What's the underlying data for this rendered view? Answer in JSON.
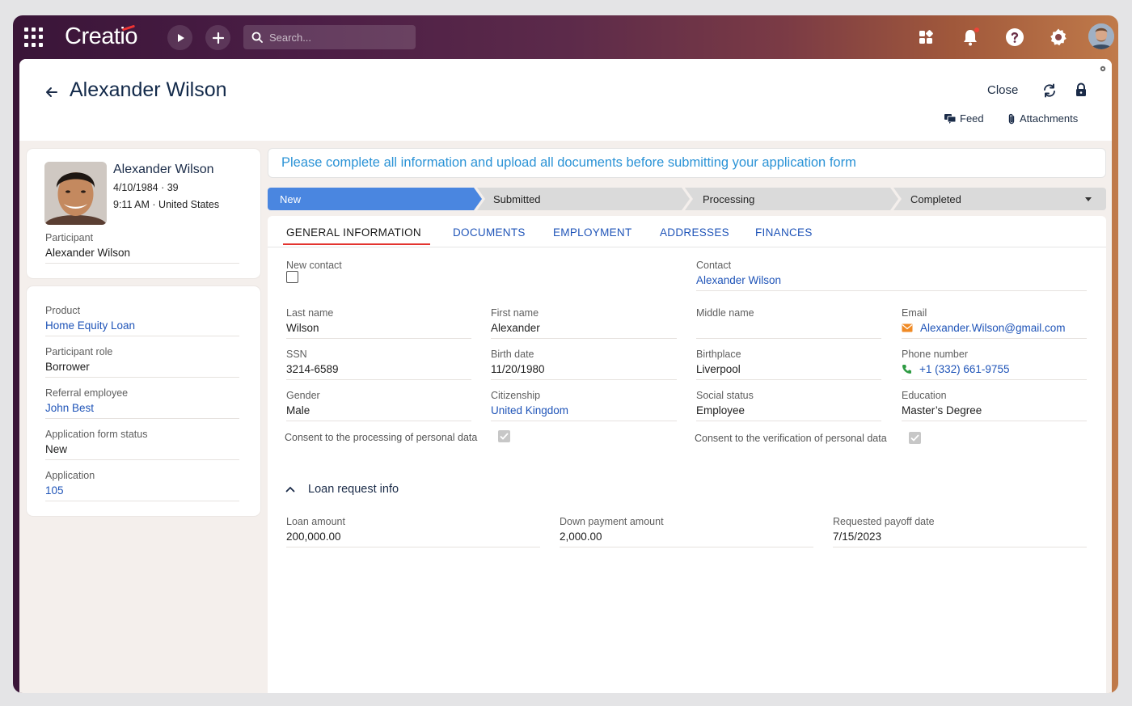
{
  "topbar": {
    "logo": "Creatio",
    "search_placeholder": "Search..."
  },
  "header": {
    "title": "Alexander Wilson",
    "close_label": "Close",
    "feed_label": "Feed",
    "attachments_label": "Attachments"
  },
  "profile": {
    "name": "Alexander Wilson",
    "dob_age": "4/10/1984 · 39",
    "time_location": "9:11 AM · United States",
    "participant_label": "Participant",
    "participant_value": "Alexander Wilson"
  },
  "details": {
    "product_label": "Product",
    "product_value": "Home Equity Loan",
    "role_label": "Participant role",
    "role_value": "Borrower",
    "referral_label": "Referral employee",
    "referral_value": "John Best",
    "status_label": "Application form status",
    "status_value": "New",
    "application_label": "Application",
    "application_value": "105"
  },
  "banner": "Please complete all information and upload all documents before submitting your application form",
  "stages": [
    "New",
    "Submitted",
    "Processing",
    "Completed"
  ],
  "tabs": [
    "GENERAL INFORMATION",
    "DOCUMENTS",
    "EMPLOYMENT",
    "ADDRESSES",
    "FINANCES"
  ],
  "general": {
    "new_contact_label": "New contact",
    "contact_label": "Contact",
    "contact_value": "Alexander Wilson",
    "last_name_label": "Last name",
    "last_name_value": "Wilson",
    "first_name_label": "First name",
    "first_name_value": "Alexander",
    "middle_name_label": "Middle name",
    "middle_name_value": "",
    "email_label": "Email",
    "email_value": "Alexander.Wilson@gmail.com",
    "ssn_label": "SSN",
    "ssn_value": "3214-6589",
    "birth_date_label": "Birth date",
    "birth_date_value": "11/20/1980",
    "birthplace_label": "Birthplace",
    "birthplace_value": "Liverpool",
    "phone_label": "Phone number",
    "phone_value": "+1 (332) 661-9755",
    "gender_label": "Gender",
    "gender_value": "Male",
    "citizenship_label": "Citizenship",
    "citizenship_value": "United Kingdom",
    "social_label": "Social status",
    "social_value": "Employee",
    "education_label": "Education",
    "education_value": "Master’s Degree",
    "consent_processing": "Consent to the processing of personal data",
    "consent_verification": "Consent to the verification of personal data"
  },
  "loan": {
    "section_title": "Loan request info",
    "amount_label": "Loan amount",
    "amount_value": "200,000.00",
    "down_label": "Down payment amount",
    "down_value": "2,000.00",
    "payoff_label": "Requested payoff date",
    "payoff_value": "7/15/2023"
  },
  "colors": {
    "accent": "#4a86e0",
    "link": "#1f54b8",
    "banner_text": "#2b93d6",
    "tab_underline": "#e3342f",
    "notification": "#ef4438"
  }
}
